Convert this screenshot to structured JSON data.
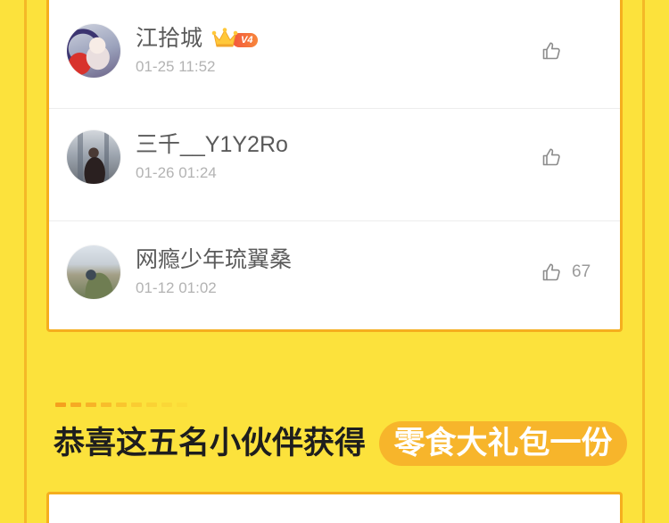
{
  "comments": [
    {
      "user_name": "江拾城",
      "vip_level": "V4",
      "time": "01-25 11:52",
      "badge_icon": "crown-icon",
      "like_icon": "thumbs-up-icon"
    },
    {
      "user_name": "三千__Y1Y2Ro",
      "time": "01-26 01:24",
      "like_icon": "thumbs-up-icon"
    },
    {
      "user_name": "网瘾少年琉翼桑",
      "time": "01-12 01:02",
      "like_icon": "thumbs-up-icon",
      "like_count": "67"
    }
  ],
  "winners": {
    "heading": "恭喜这五名小伙伴获得",
    "prize": "零食大礼包一份"
  },
  "colors": {
    "page_background": "#FCE23C",
    "panel_border": "#F4B827",
    "card_border": "#F5AE1E",
    "prize_pill": "#F7B52B",
    "vip_badge": "#F3553C",
    "name_text": "#5A5A5A",
    "time_text": "#B3B3B3"
  }
}
